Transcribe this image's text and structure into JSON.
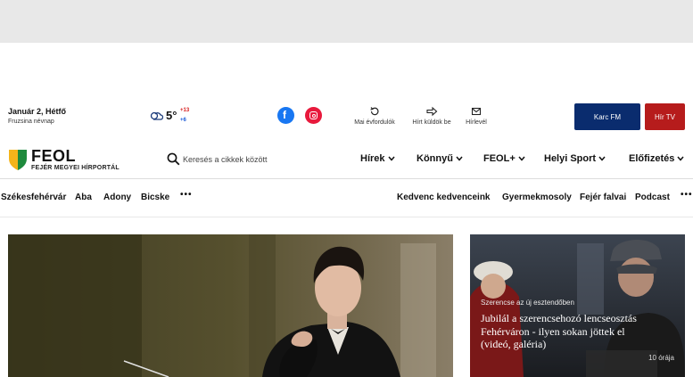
{
  "header": {
    "date": "Január 2, Hétfő",
    "nameday": "Fruzsina névnap",
    "weather": {
      "temp": "5°",
      "high": "+13",
      "low": "+6",
      "icon": "cloud-icon"
    },
    "utilities": [
      {
        "label": "Mai évfordulók",
        "icon": "history-icon"
      },
      {
        "label": "Hírt küldök be",
        "icon": "send-icon"
      },
      {
        "label": "Hírlevél",
        "icon": "mail-icon"
      }
    ],
    "radio_button": "Karc FM",
    "tv_button": "Hír TV"
  },
  "brand": {
    "name": "FEOL",
    "subtitle": "FEJÉR MEGYEI HÍRPORTÁL",
    "colors": {
      "shield_left": "#f4b41a",
      "shield_right": "#1e8a3c",
      "radio": "#0a2c6e",
      "tv": "#b61c1c"
    }
  },
  "search": {
    "placeholder": "Keresés a cikkek között"
  },
  "nav": [
    "Hírek",
    "Könnyű",
    "FEOL+",
    "Helyi Sport",
    "Előfizetés"
  ],
  "sections_left": [
    "Székesfehérvár",
    "Aba",
    "Adony",
    "Bicske",
    "•••"
  ],
  "sections_right": [
    "Kedvenc kedvenceink",
    "Gyermekmosoly",
    "Fejér falvai",
    "Podcast",
    "•••"
  ],
  "side_article": {
    "kicker": "Szerencse az új esztendőben",
    "headline": "Jubilál a szerencsehozó lencseosztás Fehérváron - ilyen sokan jöttek el (videó, galéria)",
    "time": "10 órája"
  }
}
